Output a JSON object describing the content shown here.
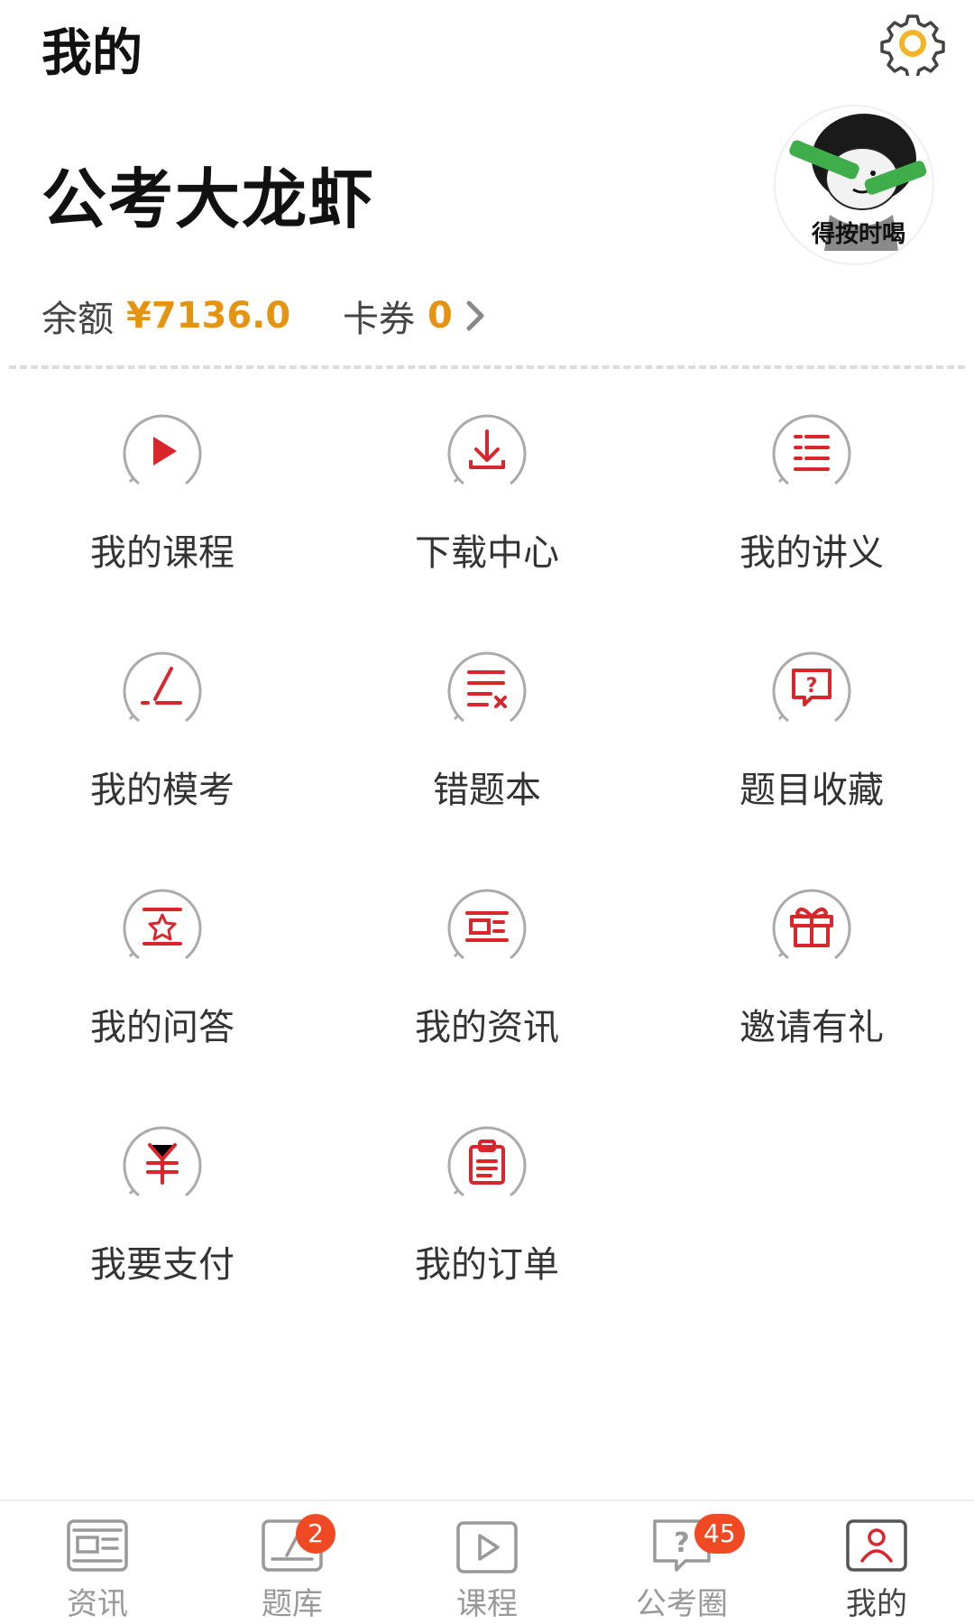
{
  "header": {
    "title": "我的",
    "settings_icon": "gear-icon"
  },
  "profile": {
    "name": "公考大龙虾",
    "avatar_caption": "得按时喝"
  },
  "wallet": {
    "balance_label": "余额",
    "balance_value": "¥7136.0",
    "coupon_label": "卡券",
    "coupon_value": "0"
  },
  "colors": {
    "accent": "#d9262c",
    "money": "#e59412",
    "badge": "#f04a24"
  },
  "menu": [
    {
      "label": "我的课程",
      "icon": "play-icon"
    },
    {
      "label": "下载中心",
      "icon": "download-icon"
    },
    {
      "label": "我的讲义",
      "icon": "list-icon"
    },
    {
      "label": "我的模考",
      "icon": "pen-icon"
    },
    {
      "label": "错题本",
      "icon": "wrong-list-icon"
    },
    {
      "label": "题目收藏",
      "icon": "question-bubble-icon"
    },
    {
      "label": "我的问答",
      "icon": "star-doc-icon"
    },
    {
      "label": "我的资讯",
      "icon": "news-icon"
    },
    {
      "label": "邀请有礼",
      "icon": "gift-icon"
    },
    {
      "label": "我要支付",
      "icon": "yuan-icon"
    },
    {
      "label": "我的订单",
      "icon": "clipboard-icon"
    }
  ],
  "tabs": [
    {
      "label": "资讯",
      "icon": "news-tab-icon",
      "badge": ""
    },
    {
      "label": "题库",
      "icon": "question-bank-tab-icon",
      "badge": "2"
    },
    {
      "label": "课程",
      "icon": "course-tab-icon",
      "badge": ""
    },
    {
      "label": "公考圈",
      "icon": "community-tab-icon",
      "badge": "45"
    },
    {
      "label": "我的",
      "icon": "profile-tab-icon",
      "badge": "",
      "active": true
    }
  ]
}
